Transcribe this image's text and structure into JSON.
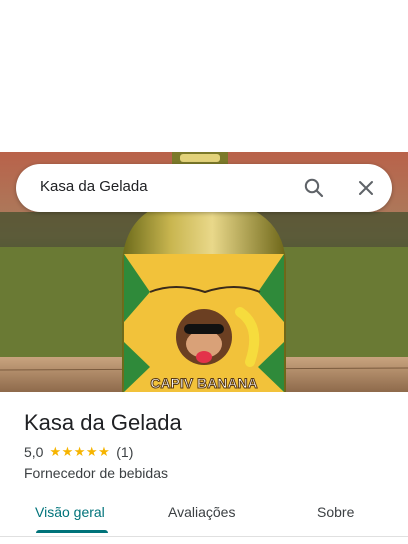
{
  "search": {
    "query": "Kasa da Gelada"
  },
  "place": {
    "name": "Kasa da Gelada",
    "rating": "5,0",
    "stars": "★★★★★",
    "review_count": "(1)",
    "category": "Fornecedor de bebidas"
  },
  "tabs": [
    {
      "label": "Visão geral",
      "active": true
    },
    {
      "label": "Avaliações",
      "active": false
    },
    {
      "label": "Sobre",
      "active": false
    }
  ],
  "photo": {
    "bottle_label_text": "CAPIV BANANA"
  },
  "colors": {
    "accent": "#00737a",
    "stars": "#f6b400",
    "text": "#202124"
  }
}
